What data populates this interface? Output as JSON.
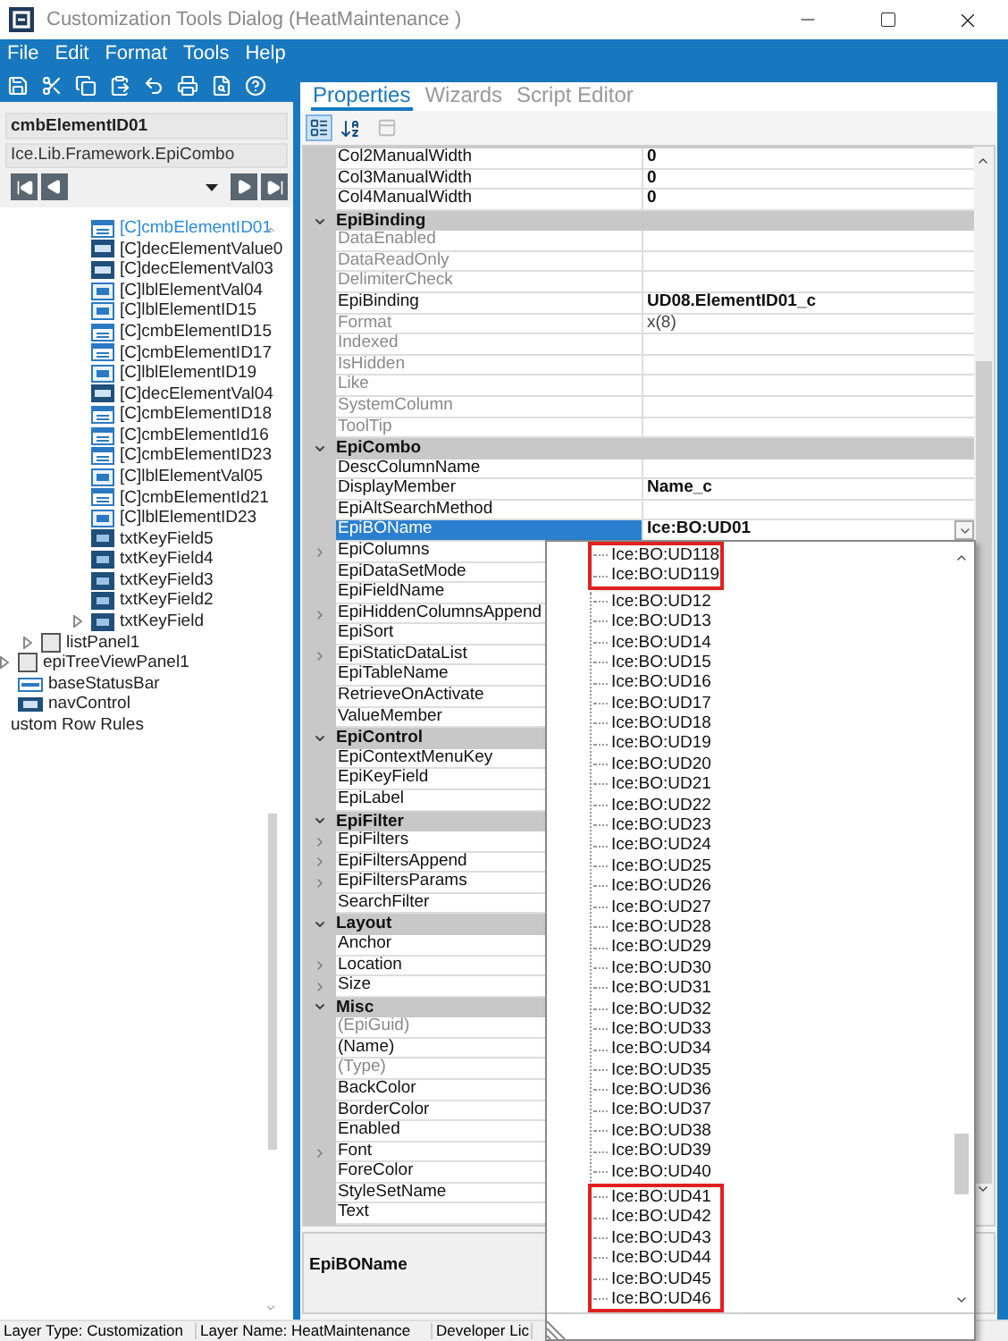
{
  "window": {
    "title": "Customization Tools Dialog  (HeatMaintenance )"
  },
  "menu": [
    "File",
    "Edit",
    "Format",
    "Tools",
    "Help"
  ],
  "left_panel": {
    "control_name": "cmbElementID01",
    "control_type": "Ice.Lib.Framework.EpiCombo",
    "tree": [
      {
        "children": [
          {
            "children": [
              {
                "children": [
                  {
                    "label": "[C]cmbElementID01",
                    "kind": "combo",
                    "selected": true,
                    "expandable": false
                  },
                  {
                    "label": "[C]decElementValue0",
                    "kind": "numeric",
                    "selected": false,
                    "expandable": false
                  },
                  {
                    "label": "[C]decElementVal03",
                    "kind": "numeric",
                    "selected": false,
                    "expandable": false
                  },
                  {
                    "label": "[C]lblElementVal04",
                    "kind": "label",
                    "selected": false,
                    "expandable": false
                  },
                  {
                    "label": "[C]lblElementID15",
                    "kind": "label",
                    "selected": false,
                    "expandable": false
                  },
                  {
                    "label": "[C]cmbElementID15",
                    "kind": "combo",
                    "selected": false,
                    "expandable": false
                  },
                  {
                    "label": "[C]cmbElementID17",
                    "kind": "combo",
                    "selected": false,
                    "expandable": false
                  },
                  {
                    "label": "[C]lblElementID19",
                    "kind": "label",
                    "selected": false,
                    "expandable": false
                  },
                  {
                    "label": "[C]decElementVal04",
                    "kind": "numeric",
                    "selected": false,
                    "expandable": false
                  },
                  {
                    "label": "[C]cmbElementID18",
                    "kind": "combo",
                    "selected": false,
                    "expandable": false
                  },
                  {
                    "label": "[C]cmbElementId16",
                    "kind": "combo",
                    "selected": false,
                    "expandable": false
                  },
                  {
                    "label": "[C]cmbElementID23",
                    "kind": "combo",
                    "selected": false,
                    "expandable": false
                  },
                  {
                    "label": "[C]lblElementVal05",
                    "kind": "label",
                    "selected": false,
                    "expandable": false
                  },
                  {
                    "label": "[C]cmbElementId21",
                    "kind": "combo",
                    "selected": false,
                    "expandable": false
                  },
                  {
                    "label": "[C]lblElementID23",
                    "kind": "label",
                    "selected": false,
                    "expandable": false
                  },
                  {
                    "label": "txtKeyField5",
                    "kind": "textbox",
                    "selected": false,
                    "expandable": false
                  },
                  {
                    "label": "txtKeyField4",
                    "kind": "textbox",
                    "selected": false,
                    "expandable": false
                  },
                  {
                    "label": "txtKeyField3",
                    "kind": "textbox",
                    "selected": false,
                    "expandable": false
                  },
                  {
                    "label": "txtKeyField2",
                    "kind": "textbox",
                    "selected": false,
                    "expandable": false
                  },
                  {
                    "label": "txtKeyField",
                    "kind": "textbox",
                    "selected": false,
                    "expandable": true
                  }
                ]
              },
              {
                "label": "listPanel1",
                "kind": "panel",
                "selected": false,
                "expandable": true
              }
            ]
          },
          {
            "label": "epiTreeViewPanel1",
            "kind": "panel",
            "selected": false,
            "expandable": true
          },
          {
            "label": "baseStatusBar",
            "kind": "statusbar",
            "selected": false,
            "expandable": false
          },
          {
            "label": "navControl",
            "kind": "nav",
            "selected": false,
            "expandable": false
          }
        ]
      },
      {
        "label": "ustom Row Rules",
        "kind": "none",
        "selected": false,
        "expandable": false
      }
    ]
  },
  "tabs": [
    {
      "label": "Properties",
      "selected": true
    },
    {
      "label": "Wizards",
      "selected": false
    },
    {
      "label": "Script Editor",
      "selected": false
    }
  ],
  "grid_toolbar": [
    {
      "kind": "categorized",
      "selected": true
    },
    {
      "kind": "alphabetical",
      "selected": false
    },
    {
      "kind": "pages",
      "selected": false
    }
  ],
  "properties": [
    {
      "kind": "property",
      "name": "Col2ManualWidth",
      "value": "0",
      "disabled": false,
      "expandable": false,
      "selected": false
    },
    {
      "kind": "property",
      "name": "Col3ManualWidth",
      "value": "0",
      "disabled": false,
      "expandable": false,
      "selected": false
    },
    {
      "kind": "property",
      "name": "Col4ManualWidth",
      "value": "0",
      "disabled": false,
      "expandable": false,
      "selected": false
    },
    {
      "kind": "category",
      "name": "EpiBinding",
      "expanded": true
    },
    {
      "kind": "property",
      "name": "DataEnabled",
      "disabled": true,
      "expandable": false,
      "selected": false
    },
    {
      "kind": "property",
      "name": "DataReadOnly",
      "disabled": true,
      "expandable": false,
      "selected": false
    },
    {
      "kind": "property",
      "name": "DelimiterCheck",
      "disabled": true,
      "expandable": false,
      "selected": false
    },
    {
      "kind": "property",
      "name": "EpiBinding",
      "value": "UD08.ElementID01_c",
      "disabled": false,
      "expandable": false,
      "selected": false
    },
    {
      "kind": "property",
      "name": "Format",
      "value": "x(8)",
      "disabled": true,
      "expandable": false,
      "selected": false
    },
    {
      "kind": "property",
      "name": "Indexed",
      "disabled": true,
      "expandable": false,
      "selected": false
    },
    {
      "kind": "property",
      "name": "IsHidden",
      "disabled": true,
      "expandable": false,
      "selected": false
    },
    {
      "kind": "property",
      "name": "Like",
      "disabled": true,
      "expandable": false,
      "selected": false
    },
    {
      "kind": "property",
      "name": "SystemColumn",
      "disabled": true,
      "expandable": false,
      "selected": false
    },
    {
      "kind": "property",
      "name": "ToolTip",
      "disabled": true,
      "expandable": false,
      "selected": false
    },
    {
      "kind": "category",
      "name": "EpiCombo",
      "expanded": true
    },
    {
      "kind": "property",
      "name": "DescColumnName",
      "disabled": false,
      "expandable": false,
      "selected": false
    },
    {
      "kind": "property",
      "name": "DisplayMember",
      "value": "Name_c",
      "disabled": false,
      "expandable": false,
      "selected": false
    },
    {
      "kind": "property",
      "name": "EpiAltSearchMethod",
      "disabled": false,
      "expandable": false,
      "selected": false
    },
    {
      "kind": "property",
      "name": "EpiBOName",
      "value": "Ice:BO:UD01",
      "disabled": false,
      "expandable": false,
      "selected": true
    },
    {
      "kind": "property",
      "name": "EpiColumns",
      "disabled": false,
      "expandable": true,
      "selected": false
    },
    {
      "kind": "property",
      "name": "EpiDataSetMode",
      "disabled": false,
      "expandable": false,
      "selected": false
    },
    {
      "kind": "property",
      "name": "EpiFieldName",
      "disabled": false,
      "expandable": false,
      "selected": false
    },
    {
      "kind": "property",
      "name": "EpiHiddenColumnsAppend",
      "disabled": false,
      "expandable": true,
      "selected": false
    },
    {
      "kind": "property",
      "name": "EpiSort",
      "disabled": false,
      "expandable": false,
      "selected": false
    },
    {
      "kind": "property",
      "name": "EpiStaticDataList",
      "disabled": false,
      "expandable": true,
      "selected": false
    },
    {
      "kind": "property",
      "name": "EpiTableName",
      "disabled": false,
      "expandable": false,
      "selected": false
    },
    {
      "kind": "property",
      "name": "RetrieveOnActivate",
      "disabled": false,
      "expandable": false,
      "selected": false
    },
    {
      "kind": "property",
      "name": "ValueMember",
      "disabled": false,
      "expandable": false,
      "selected": false
    },
    {
      "kind": "category",
      "name": "EpiControl",
      "expanded": true
    },
    {
      "kind": "property",
      "name": "EpiContextMenuKey",
      "disabled": false,
      "expandable": false,
      "selected": false
    },
    {
      "kind": "property",
      "name": "EpiKeyField",
      "disabled": false,
      "expandable": false,
      "selected": false
    },
    {
      "kind": "property",
      "name": "EpiLabel",
      "disabled": false,
      "expandable": false,
      "selected": false
    },
    {
      "kind": "category",
      "name": "EpiFilter",
      "expanded": true
    },
    {
      "kind": "property",
      "name": "EpiFilters",
      "disabled": false,
      "expandable": true,
      "selected": false
    },
    {
      "kind": "property",
      "name": "EpiFiltersAppend",
      "disabled": false,
      "expandable": true,
      "selected": false
    },
    {
      "kind": "property",
      "name": "EpiFiltersParams",
      "disabled": false,
      "expandable": true,
      "selected": false
    },
    {
      "kind": "property",
      "name": "SearchFilter",
      "disabled": false,
      "expandable": false,
      "selected": false
    },
    {
      "kind": "category",
      "name": "Layout",
      "expanded": true
    },
    {
      "kind": "property",
      "name": "Anchor",
      "disabled": false,
      "expandable": false,
      "selected": false
    },
    {
      "kind": "property",
      "name": "Location",
      "disabled": false,
      "expandable": true,
      "selected": false
    },
    {
      "kind": "property",
      "name": "Size",
      "disabled": false,
      "expandable": true,
      "selected": false
    },
    {
      "kind": "category",
      "name": "Misc",
      "expanded": true
    },
    {
      "kind": "property",
      "name": "(EpiGuid)",
      "disabled": true,
      "expandable": false,
      "selected": false
    },
    {
      "kind": "property",
      "name": "(Name)",
      "disabled": false,
      "expandable": false,
      "selected": false
    },
    {
      "kind": "property",
      "name": "(Type)",
      "disabled": true,
      "expandable": false,
      "selected": false
    },
    {
      "kind": "property",
      "name": "BackColor",
      "disabled": false,
      "expandable": false,
      "selected": false
    },
    {
      "kind": "property",
      "name": "BorderColor",
      "disabled": false,
      "expandable": false,
      "selected": false
    },
    {
      "kind": "property",
      "name": "Enabled",
      "disabled": false,
      "expandable": false,
      "selected": false
    },
    {
      "kind": "property",
      "name": "Font",
      "disabled": false,
      "expandable": true,
      "selected": false
    },
    {
      "kind": "property",
      "name": "ForeColor",
      "disabled": false,
      "expandable": false,
      "selected": false
    },
    {
      "kind": "property",
      "name": "StyleSetName",
      "disabled": false,
      "expandable": false,
      "selected": false
    },
    {
      "kind": "property",
      "name": "Text",
      "disabled": false,
      "expandable": false,
      "selected": false
    }
  ],
  "dropdown": {
    "groups": [
      {
        "highlighted": true,
        "items": [
          "Ice:BO:UD118",
          "Ice:BO:UD119"
        ]
      },
      {
        "highlighted": false,
        "items": [
          "Ice:BO:UD12",
          "Ice:BO:UD13",
          "Ice:BO:UD14",
          "Ice:BO:UD15",
          "Ice:BO:UD16",
          "Ice:BO:UD17",
          "Ice:BO:UD18",
          "Ice:BO:UD19",
          "Ice:BO:UD20",
          "Ice:BO:UD21",
          "Ice:BO:UD22",
          "Ice:BO:UD23",
          "Ice:BO:UD24",
          "Ice:BO:UD25",
          "Ice:BO:UD26",
          "Ice:BO:UD27",
          "Ice:BO:UD28",
          "Ice:BO:UD29",
          "Ice:BO:UD30",
          "Ice:BO:UD31",
          "Ice:BO:UD32",
          "Ice:BO:UD33",
          "Ice:BO:UD34",
          "Ice:BO:UD35",
          "Ice:BO:UD36",
          "Ice:BO:UD37",
          "Ice:BO:UD38",
          "Ice:BO:UD39",
          "Ice:BO:UD40"
        ]
      },
      {
        "highlighted": true,
        "items": [
          "Ice:BO:UD41",
          "Ice:BO:UD42",
          "Ice:BO:UD43",
          "Ice:BO:UD44",
          "Ice:BO:UD45",
          "Ice:BO:UD46"
        ]
      }
    ]
  },
  "description": {
    "title": "EpiBOName"
  },
  "status_bar": [
    "Layer Type:  Customization",
    "Layer Name:  HeatMaintenance",
    "Developer Lic"
  ]
}
